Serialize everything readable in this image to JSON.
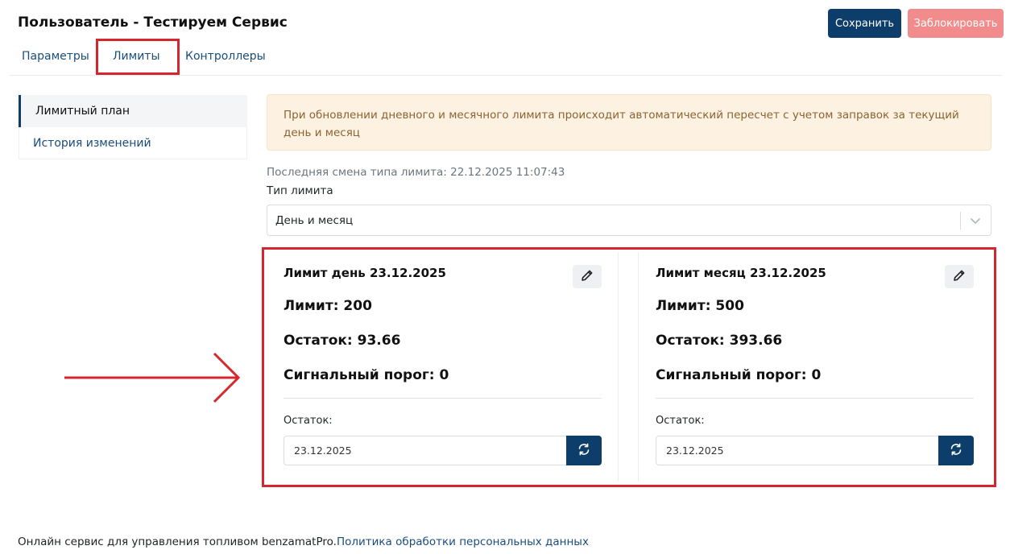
{
  "header": {
    "title": "Пользователь - Тестируем Сервис",
    "save_label": "Сохранить",
    "block_label": "Заблокировать"
  },
  "tabs": [
    {
      "label": "Параметры"
    },
    {
      "label": "Лимиты",
      "active": true
    },
    {
      "label": "Контроллеры"
    }
  ],
  "sidebar": {
    "items": [
      {
        "label": "Лимитный план",
        "active": true
      },
      {
        "label": "История изменений"
      }
    ]
  },
  "alert": {
    "text": "При обновлении дневного и месячного лимита происходит автоматический пересчет с учетом заправок за текущий день и месяц"
  },
  "limit_type": {
    "last_change": "Последняя смена типа лимита: 22.12.2025 11:07:43",
    "label": "Тип лимита",
    "value": "День и месяц"
  },
  "cards": [
    {
      "title": "Лимит день 23.12.2025",
      "limit": "Лимит: 200",
      "rest": "Остаток: 93.66",
      "signal": "Сигнальный порог: 0",
      "rest_label": "Остаток:",
      "date": "23.12.2025"
    },
    {
      "title": "Лимит месяц 23.12.2025",
      "limit": "Лимит: 500",
      "rest": "Остаток: 393.66",
      "signal": "Сигнальный порог: 0",
      "rest_label": "Остаток:",
      "date": "23.12.2025"
    }
  ],
  "footer": {
    "text": "Онлайн сервис для управления топливом benzamatPro.",
    "link": "Политика обработки персональных данных"
  },
  "colors": {
    "primary": "#0d3d6b",
    "danger_light": "#f28b8b",
    "highlight": "#d6262d",
    "alert_bg": "#fdf1e1"
  },
  "icons": [
    "pencil-icon",
    "refresh-icon",
    "chevron-down-icon"
  ]
}
